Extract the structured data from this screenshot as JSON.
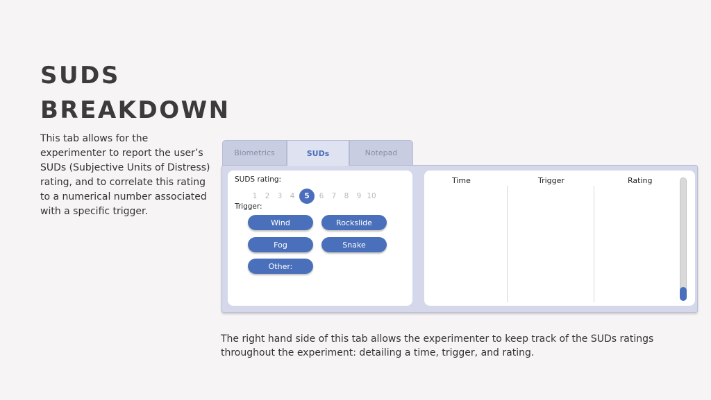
{
  "slide": {
    "title_line1": "SUDS",
    "title_line2": "BREAKDOWN",
    "description": "This tab allows for the experimenter to report the user’s SUDs (Subjective Units of Distress) rating, and to correlate this rating to a numerical number associated with a specific trigger.",
    "bottom_description": "The right hand side of this tab allows the experimenter to keep track of the SUDs ratings throughout the experiment: detailing a time, trigger, and rating."
  },
  "app": {
    "tabs": [
      "Biometrics",
      "SUDs",
      "Notepad"
    ],
    "active_tab": "SUDs",
    "suds_label": "SUDS rating:",
    "scale": [
      "1",
      "2",
      "3",
      "4",
      "5",
      "6",
      "7",
      "8",
      "9",
      "10"
    ],
    "selected_rating": "5",
    "trigger_label": "Trigger:",
    "triggers": [
      "Wind",
      "Rockslide",
      "Fog",
      "Snake",
      "Other:"
    ],
    "table_headers": [
      "Time",
      "Trigger",
      "Rating"
    ],
    "colors": {
      "accent": "#4a6ebd",
      "frame": "#d4d8ea"
    }
  }
}
